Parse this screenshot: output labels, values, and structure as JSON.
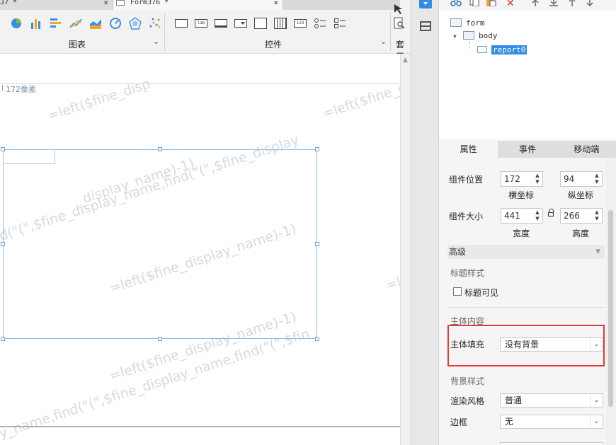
{
  "tabs": {
    "tab1_label": "J7 *",
    "tab2_label": "Form376 *",
    "close_glyph": "×"
  },
  "toolbar": {
    "chart_group_label": "图表",
    "controls_group_label": "控件",
    "third_group_label": "套用",
    "chevron": "⌄",
    "control_labels": [
      "",
      "lab",
      "",
      "",
      "",
      "",
      "123",
      "",
      ""
    ]
  },
  "canvas": {
    "ruler_label": "172像素",
    "watermark_text_1": "=left($fine_disp",
    "watermark_text_2": "=left($fine_c",
    "watermark_text_3": "_display_name)-1)",
    "watermark_text_4": "d(\"(\",$fine_display_name,find(\"(\",$fine_display",
    "watermark_text_5": "=left($fine_display_name)-1)",
    "watermark_text_6": "=left($fine_display_name)-1)",
    "watermark_text_7": "y_name,find(\"(\",$fine_display_name,find(\"(\",$fin",
    "watermark_text_8": "=le"
  },
  "tree": {
    "root_label": "form",
    "body_label": "body",
    "report_label": "report0"
  },
  "panel_tabs": [
    "属性",
    "事件",
    "移动端"
  ],
  "props": {
    "position_label": "组件位置",
    "x_value": "172",
    "y_value": "94",
    "x_caption": "横坐标",
    "y_caption": "纵坐标",
    "size_label": "组件大小",
    "width_value": "441",
    "height_value": "266",
    "width_caption": "宽度",
    "height_caption": "高度",
    "advanced_label": "高级",
    "title_style_label": "标题样式",
    "title_visible_label": "标题可见",
    "body_content_label": "主体内容",
    "body_fill_label": "主体填充",
    "body_fill_value": "没有背景",
    "bg_style_label": "背景样式",
    "render_style_label": "渲染风格",
    "render_style_value": "普通",
    "border_label": "边框",
    "border_value": "无"
  },
  "colors": {
    "accent": "#2f8de4",
    "highlight_border": "#e53935",
    "selection_border": "#8fb9e6"
  }
}
